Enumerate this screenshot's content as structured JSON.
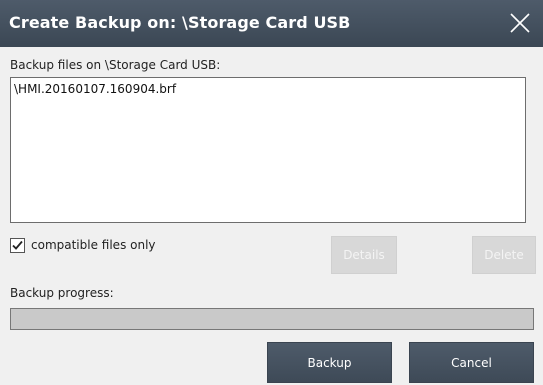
{
  "window": {
    "title": "Create Backup on: \\Storage Card USB",
    "close_icon": "close-icon"
  },
  "files_label": "Backup files on \\Storage Card USB:",
  "files": [
    {
      "name": "\\HMI.20160107.160904.brf"
    }
  ],
  "compatible_only": {
    "label": "compatible files only",
    "checked": true
  },
  "buttons": {
    "details": "Details",
    "delete": "Delete",
    "backup": "Backup",
    "cancel": "Cancel"
  },
  "progress": {
    "label": "Backup progress:",
    "value": 0
  },
  "colors": {
    "titlebar": "#46525f",
    "primary_button": "#46525f",
    "disabled_button": "#d8d8d8"
  }
}
